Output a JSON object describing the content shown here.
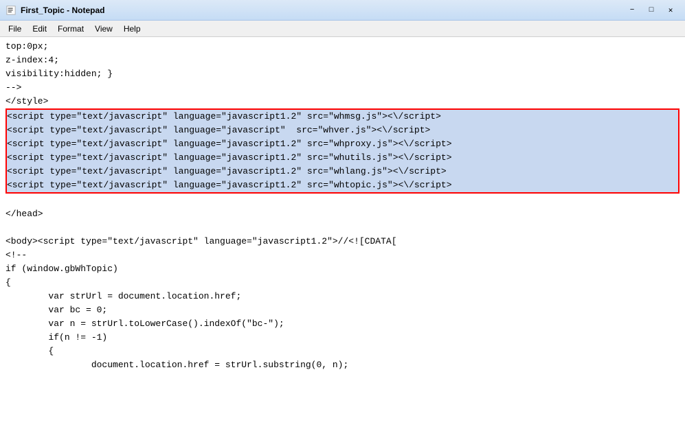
{
  "titleBar": {
    "title": "First_Topic - Notepad",
    "icon": "notepad-icon",
    "controls": {
      "minimize": "−",
      "maximize": "□",
      "close": "✕"
    }
  },
  "menuBar": {
    "items": [
      {
        "id": "file",
        "label": "File"
      },
      {
        "id": "edit",
        "label": "Edit"
      },
      {
        "id": "format",
        "label": "Format"
      },
      {
        "id": "view",
        "label": "View"
      },
      {
        "id": "help",
        "label": "Help"
      }
    ]
  },
  "content": {
    "lines": [
      {
        "id": "line1",
        "text": "top:0px;",
        "highlighted": false
      },
      {
        "id": "line2",
        "text": "z-index:4;",
        "highlighted": false
      },
      {
        "id": "line3",
        "text": "visibility:hidden; }",
        "highlighted": false
      },
      {
        "id": "line4",
        "text": "-->",
        "highlighted": false
      },
      {
        "id": "line5",
        "text": "</style>",
        "highlighted": false
      },
      {
        "id": "line6",
        "text": "<script type=\"text/javascript\" language=\"javascript1.2\" src=\"whmsg.js\"><\\/script>",
        "highlighted": true
      },
      {
        "id": "line7",
        "text": "<script type=\"text/javascript\" language=\"javascript\"  src=\"whver.js\"><\\/script>",
        "highlighted": true
      },
      {
        "id": "line8",
        "text": "<script type=\"text/javascript\" language=\"javascript1.2\" src=\"whproxy.js\"><\\/script>",
        "highlighted": true
      },
      {
        "id": "line9",
        "text": "<script type=\"text/javascript\" language=\"javascript1.2\" src=\"whutils.js\"><\\/script>",
        "highlighted": true
      },
      {
        "id": "line10",
        "text": "<script type=\"text/javascript\" language=\"javascript1.2\" src=\"whlang.js\"><\\/script>",
        "highlighted": true
      },
      {
        "id": "line11",
        "text": "<script type=\"text/javascript\" language=\"javascript1.2\" src=\"whtopic.js\"><\\/script>",
        "highlighted": true
      },
      {
        "id": "line12",
        "text": "",
        "highlighted": false
      },
      {
        "id": "line13",
        "text": "</head>",
        "highlighted": false
      },
      {
        "id": "line14",
        "text": "",
        "highlighted": false
      },
      {
        "id": "line15",
        "text": "<body><script type=\"text/javascript\" language=\"javascript1.2\">//<![CDATA[",
        "highlighted": false
      },
      {
        "id": "line16",
        "text": "<!--",
        "highlighted": false
      },
      {
        "id": "line17",
        "text": "if (window.gbWhTopic)",
        "highlighted": false
      },
      {
        "id": "line18",
        "text": "{",
        "highlighted": false
      },
      {
        "id": "line19",
        "text": "        var strUrl = document.location.href;",
        "highlighted": false
      },
      {
        "id": "line20",
        "text": "        var bc = 0;",
        "highlighted": false
      },
      {
        "id": "line21",
        "text": "        var n = strUrl.toLowerCase().indexOf(\"bc-\");",
        "highlighted": false
      },
      {
        "id": "line22",
        "text": "        if(n != -1)",
        "highlighted": false
      },
      {
        "id": "line23",
        "text": "        {",
        "highlighted": false
      },
      {
        "id": "line24",
        "text": "                document.location.href = strUrl.substring(0, n);",
        "highlighted": false
      }
    ]
  }
}
